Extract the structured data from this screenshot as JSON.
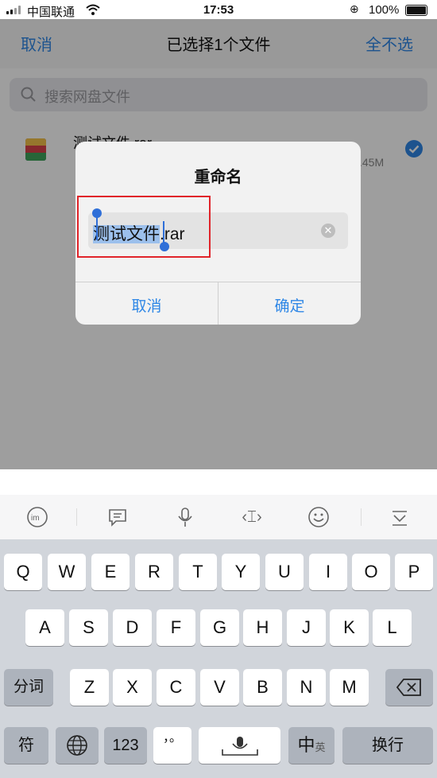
{
  "status_bar": {
    "carrier": "中国联通",
    "time": "17:53",
    "battery_percent": "100%"
  },
  "nav": {
    "cancel_label": "取消",
    "title": "已选择1个文件",
    "deselect_all_label": "全不选"
  },
  "search": {
    "placeholder": "搜索网盘文件"
  },
  "file_list": [
    {
      "name": "测试文件.rar",
      "size_fragment": ".45M",
      "selected": true
    }
  ],
  "rename_dialog": {
    "title": "重命名",
    "input_selected_text": "测试文件",
    "input_extension": ".rar",
    "cancel_label": "取消",
    "confirm_label": "确定"
  },
  "keyboard": {
    "toolbar_icons": [
      "ime-logo-icon",
      "message-icon",
      "microphone-icon",
      "cursor-icon",
      "emoji-icon",
      "collapse-keyboard-icon"
    ],
    "row1": [
      "Q",
      "W",
      "E",
      "R",
      "T",
      "Y",
      "U",
      "I",
      "O",
      "P"
    ],
    "row2": [
      "A",
      "S",
      "D",
      "F",
      "G",
      "H",
      "J",
      "K",
      "L"
    ],
    "row3": [
      "Z",
      "X",
      "C",
      "V",
      "B",
      "N",
      "M"
    ],
    "segment_key": "分词",
    "symbol_key": "符",
    "number_key": "123",
    "punctuation_key": "，。",
    "lang_key_main": "中",
    "lang_key_sub": "英",
    "return_key": "换行"
  },
  "colors": {
    "accent": "#2f87e6",
    "highlight_box": "#e0242a",
    "selection": "#9cc0ec"
  }
}
